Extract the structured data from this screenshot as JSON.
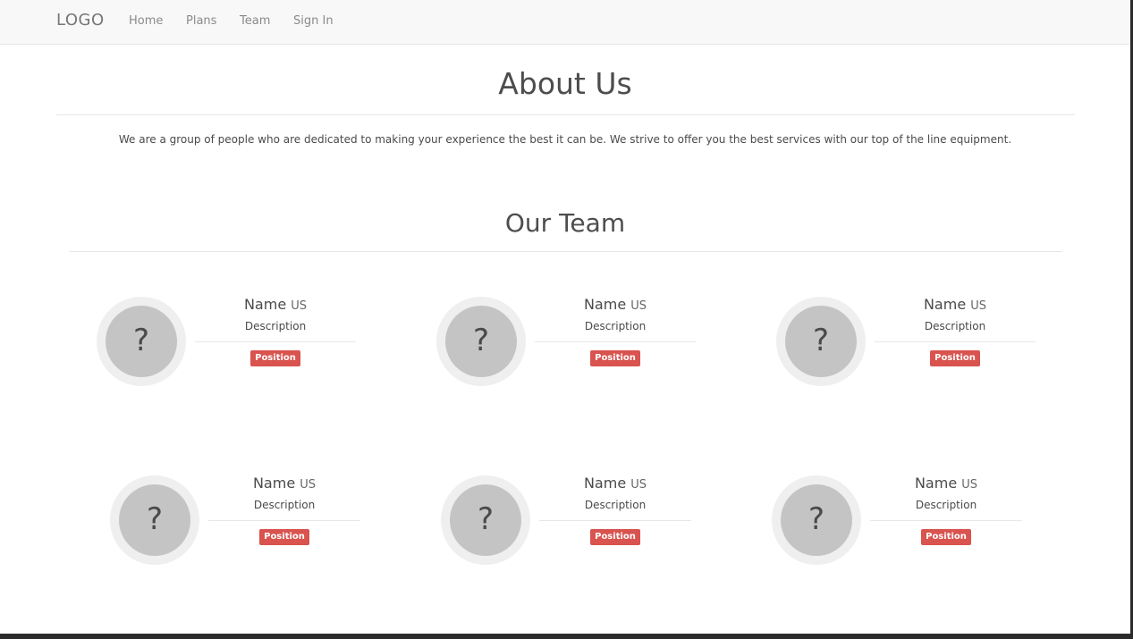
{
  "navbar": {
    "logo": "LOGO",
    "links": [
      "Home",
      "Plans",
      "Team",
      "Sign In"
    ]
  },
  "about": {
    "title": "About Us",
    "text": "We are a group of people who are dedicated to making your experience the best it can be. We strive to offer you the best services with our top of the line equipment."
  },
  "team": {
    "title": "Our Team",
    "members": [
      {
        "name": "Name",
        "sub": "US",
        "description": "Description",
        "position": "Position",
        "avatar": "?"
      },
      {
        "name": "Name",
        "sub": "US",
        "description": "Description",
        "position": "Position",
        "avatar": "?"
      },
      {
        "name": "Name",
        "sub": "US",
        "description": "Description",
        "position": "Position",
        "avatar": "?"
      },
      {
        "name": "Name",
        "sub": "US",
        "description": "Description",
        "position": "Position",
        "avatar": "?"
      },
      {
        "name": "Name",
        "sub": "US",
        "description": "Description",
        "position": "Position",
        "avatar": "?"
      },
      {
        "name": "Name",
        "sub": "US",
        "description": "Description",
        "position": "Position",
        "avatar": "?"
      }
    ]
  },
  "colors": {
    "badge": "#d9534f",
    "navbar_bg": "#f8f8f8",
    "avatar_outer": "#efefef",
    "avatar_inner": "#c4c4c4"
  }
}
